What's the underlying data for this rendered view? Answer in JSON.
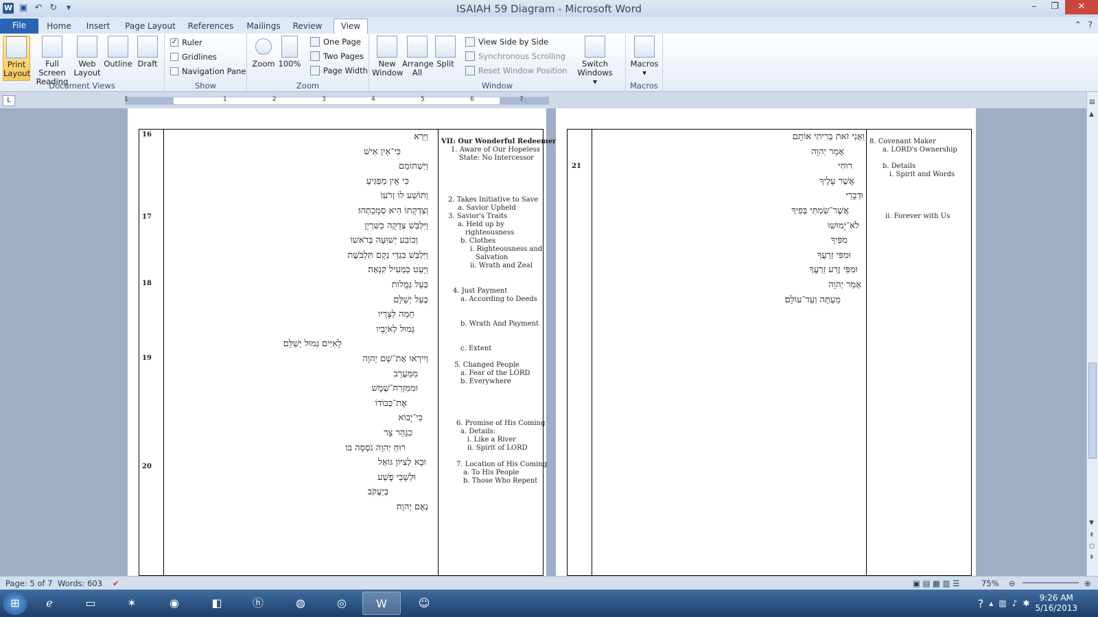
{
  "window": {
    "title": "ISAIAH 59 Diagram - Microsoft Word",
    "app_icon": "W"
  },
  "tabs": [
    "File",
    "Home",
    "Insert",
    "Page Layout",
    "References",
    "Mailings",
    "Review",
    "View"
  ],
  "active_tab": "View",
  "ribbon": {
    "document_views": {
      "label": "Document Views",
      "buttons": [
        "Print Layout",
        "Full Screen Reading",
        "Web Layout",
        "Outline",
        "Draft"
      ]
    },
    "show": {
      "label": "Show",
      "ruler": "Ruler",
      "gridlines": "Gridlines",
      "navigation_pane": "Navigation Pane"
    },
    "zoom": {
      "label": "Zoom",
      "zoom": "Zoom",
      "hundred": "100%",
      "one_page": "One Page",
      "two_pages": "Two Pages",
      "page_width": "Page Width"
    },
    "window": {
      "label": "Window",
      "new_window": "New Window",
      "arrange_all": "Arrange All",
      "split": "Split",
      "side_by_side": "View Side by Side",
      "sync_scroll": "Synchronous Scrolling",
      "reset_pos": "Reset Window Position",
      "switch_windows": "Switch Windows"
    },
    "macros": {
      "label": "Macros",
      "macros": "Macros"
    }
  },
  "ruler_numbers": [
    "1",
    "1",
    "2",
    "3",
    "4",
    "5",
    "6",
    "7"
  ],
  "page1": {
    "verses": [
      "16",
      "17",
      "18",
      "19",
      "20"
    ],
    "hebrew": [
      "וַיַּרְא",
      "כִּי־אֵין אִישׁ",
      "וַיִּשְׁתּוֹמֵם",
      "כִּי אֵין מַפְגִּיעַ",
      "וַתּוֹשַׁע לוֹ זְרֹעוֹ",
      "וְצִדְקָתוֹ הִיא סְמָכָתְהוּ׃",
      "וַיִּלְבַּשׁ צְדָקָה כַּשִּׁרְיָן",
      "וְכוֹבַע יְשׁוּעָה בְּרֹאשׁוֹ",
      "וַיִּלְבַּשׁ בִּגְדֵי נָקָם תִּלְבֹּשֶׁת",
      "וַיַּעַט כַּמְעִיל קִנְאָה׃",
      "כְּעַל גְּמֻלוֹת",
      "כְּעַל יְשַׁלֵּם",
      "חֵמָה לְצָרָיו",
      "גְּמוּל לְאֹיְבָיו",
      "לָאִיִּים גְּמוּל יְשַׁלֵּם׃",
      "וְיִירְאוּ אֶת־שֵׁם יְהוָה",
      "מִמַּעֲרָב",
      "וּמִמִּזְרַח־שֶׁמֶשׁ",
      "אֶת־כְּבוֹדוֹ",
      "כִּי־יָבוֹא",
      "כַנָּהָר צָר",
      "רוּחַ יְהוָה נֹסְסָה בוֹ׃",
      "וּבָא לְצִיּוֹן גּוֹאֵל",
      "וּלְשָׁבֵי פֶשַׁע",
      "בְּיַעֲקֹב",
      "נְאֻם יְהוָה׃"
    ],
    "outline": [
      "VII: Our Wonderful Redeemer",
      "1. Aware of Our Hopeless",
      "State: No Intercessor",
      "2. Takes Initiative to Save",
      "a. Savior Upheld",
      "3. Savior's Traits",
      "a. Held up by",
      "righteousness",
      "b. Clothes",
      "i. Righteousness and",
      "Salvation",
      "ii. Wrath and Zeal",
      "4. Just Payment",
      "a. According to Deeds",
      "b. Wrath And Payment",
      "c. Extent",
      "5. Changed People",
      "a. Fear of the LORD",
      "b. Everywhere",
      "6. Promise of His Coming",
      "a. Details:",
      "i. Like a River",
      "ii. Spirit of LORD",
      "7. Location of His Coming",
      "a. To His People",
      "b. Those Who Repent"
    ]
  },
  "page2": {
    "verses": [
      "21"
    ],
    "hebrew": [
      "וַאֲנִי זֹאת בְּרִיתִי אוֹתָם",
      "אָמַר יְהוָה",
      "רוּחִי",
      "אֲשֶׁר עָלֶיךָ",
      "וּדְבָרַי",
      "אֲשֶׁר־שַׂמְתִּי בְּפִיךָ",
      "לֹא־יָמוּשׁוּ",
      "מִפִּיךָ",
      "וּמִפִּי זַרְעֲךָ",
      "וּמִפִּי זֶרַע זַרְעֲךָ",
      "אָמַר יְהוָה",
      "מֵעַתָּה וְעַד־עוֹלָם׃"
    ],
    "outline": [
      "8. Covenant Maker",
      "a. LORD's Ownership",
      "b. Details",
      "i. Spirit and Words",
      "ii. Forever with Us"
    ]
  },
  "status": {
    "page": "Page: 5 of 7",
    "words": "Words: 603",
    "zoom": "75%"
  },
  "clock": {
    "time": "9:26 AM",
    "date": "5/16/2013"
  }
}
